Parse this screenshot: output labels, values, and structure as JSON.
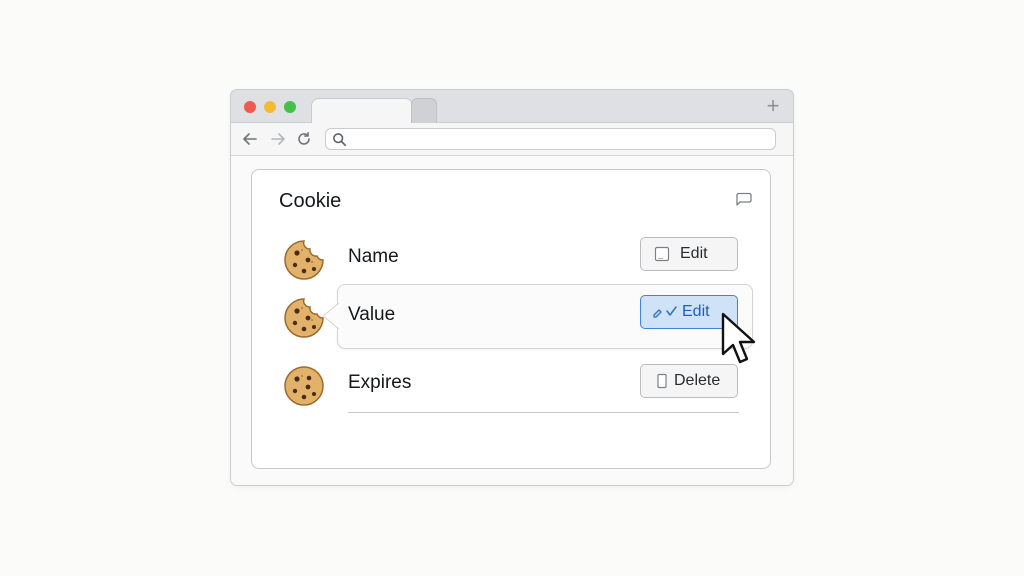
{
  "browser": {
    "url_value": "",
    "new_tab_symbol": "+"
  },
  "panel": {
    "title": "Cookie",
    "rows": [
      {
        "label": "Name",
        "icon": "cookie-icon",
        "action": {
          "label": "Edit",
          "icon": "edit-square-icon"
        }
      },
      {
        "label": "Value",
        "icon": "cookie-icon",
        "action": {
          "label": "Edit",
          "icon": "pencil-check-icon",
          "state": "active"
        }
      },
      {
        "label": "Expires",
        "icon": "cookie-icon",
        "action": {
          "label": "Delete",
          "icon": "trash-icon"
        }
      }
    ]
  },
  "colors": {
    "accent": "#3f82d8",
    "accent_fill": "#cfe2f8",
    "traffic_red": "#ed5a4f",
    "traffic_yellow": "#f5b936",
    "traffic_green": "#44c048"
  }
}
